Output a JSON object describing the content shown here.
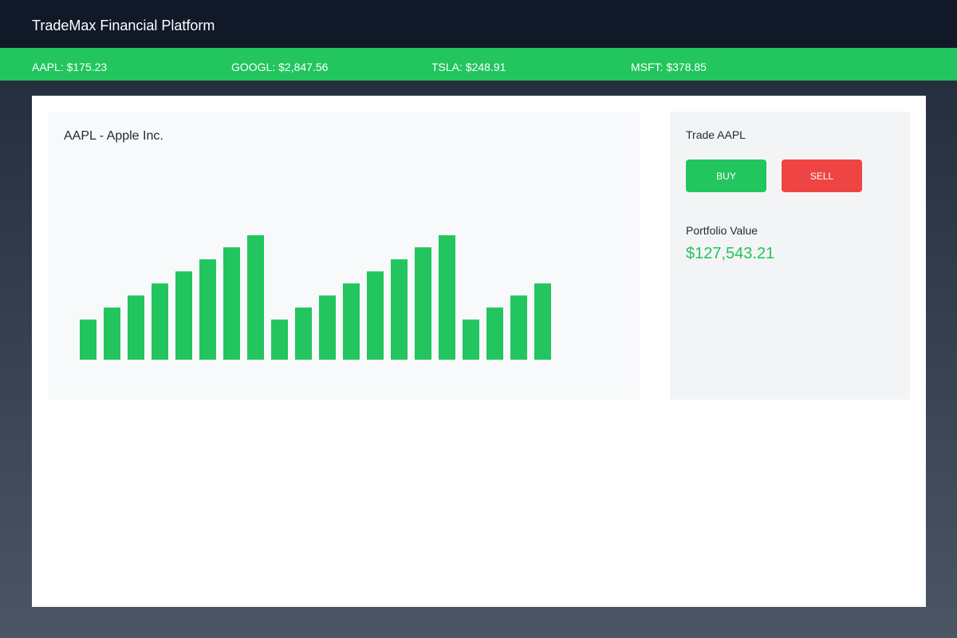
{
  "app": {
    "title": "TradeMax Financial Platform"
  },
  "ticker": [
    {
      "symbol": "AAPL",
      "label": "AAPL: $175.23"
    },
    {
      "symbol": "GOOGL",
      "label": "GOOGL: $2,847.56"
    },
    {
      "symbol": "TSLA",
      "label": "TSLA: $248.91"
    },
    {
      "symbol": "MSFT",
      "label": "MSFT: $378.85"
    }
  ],
  "chart": {
    "title": "AAPL - Apple Inc."
  },
  "chart_data": {
    "type": "bar",
    "title": "AAPL - Apple Inc.",
    "xlabel": "",
    "ylabel": "",
    "grid": false,
    "values": [
      50,
      65,
      80,
      95,
      110,
      125,
      140,
      155,
      50,
      65,
      80,
      95,
      110,
      125,
      140,
      155,
      50,
      65,
      80,
      95
    ],
    "ylim": [
      0,
      155
    ],
    "color": "#22c55e"
  },
  "trade": {
    "title": "Trade AAPL",
    "buy_label": "BUY",
    "sell_label": "SELL",
    "buy_color": "#22c55e",
    "sell_color": "#ef4444"
  },
  "portfolio": {
    "label": "Portfolio Value",
    "value": "$127,543.21"
  },
  "colors": {
    "header_bg": "#111827",
    "ticker_bg": "#22c55e",
    "accent": "#22c55e"
  }
}
